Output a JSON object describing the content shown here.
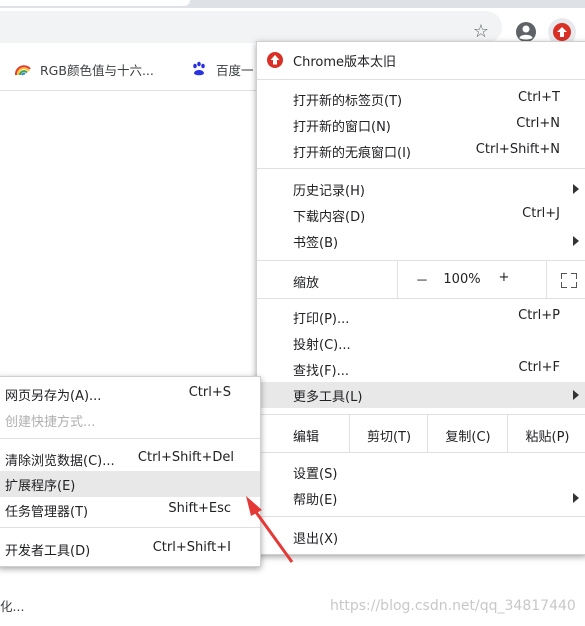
{
  "update_menu": {
    "label": "Chrome版本太旧"
  },
  "bookmarks": [
    {
      "label": "RGB颜色值与十六..."
    },
    {
      "label": "百度一"
    }
  ],
  "main_menu": {
    "new_tab": {
      "label": "打开新的标签页(T)",
      "shortcut": "Ctrl+T"
    },
    "new_window": {
      "label": "打开新的窗口(N)",
      "shortcut": "Ctrl+N"
    },
    "new_incognito": {
      "label": "打开新的无痕窗口(I)",
      "shortcut": "Ctrl+Shift+N"
    },
    "history": {
      "label": "历史记录(H)"
    },
    "downloads": {
      "label": "下载内容(D)",
      "shortcut": "Ctrl+J"
    },
    "bookmarks": {
      "label": "书签(B)"
    },
    "zoom": {
      "label": "缩放",
      "minus": "－",
      "value": "100%",
      "plus": "+"
    },
    "print": {
      "label": "打印(P)...",
      "shortcut": "Ctrl+P"
    },
    "cast": {
      "label": "投射(C)..."
    },
    "find": {
      "label": "查找(F)...",
      "shortcut": "Ctrl+F"
    },
    "more_tools": {
      "label": "更多工具(L)"
    },
    "edit": {
      "label": "编辑",
      "cut": "剪切(T)",
      "copy": "复制(C)",
      "paste": "粘贴(P)"
    },
    "settings": {
      "label": "设置(S)"
    },
    "help": {
      "label": "帮助(E)"
    },
    "exit": {
      "label": "退出(X)"
    }
  },
  "sub_menu": {
    "save_page": {
      "label": "网页另存为(A)...",
      "shortcut": "Ctrl+S"
    },
    "create_shortcut": {
      "label": "创建快捷方式..."
    },
    "clear_data": {
      "label": "清除浏览数据(C)...",
      "shortcut": "Ctrl+Shift+Del"
    },
    "extensions": {
      "label": "扩展程序(E)"
    },
    "task_manager": {
      "label": "任务管理器(T)",
      "shortcut": "Shift+Esc"
    },
    "dev_tools": {
      "label": "开发者工具(D)",
      "shortcut": "Ctrl+Shift+I"
    }
  },
  "page": {
    "bottom_text": "化..."
  },
  "watermark": "https://blog.csdn.net/qq_34817440",
  "colors": {
    "update_red": "#d93025",
    "annotation_red": "#e53935",
    "highlight": "#e8e8e8"
  }
}
